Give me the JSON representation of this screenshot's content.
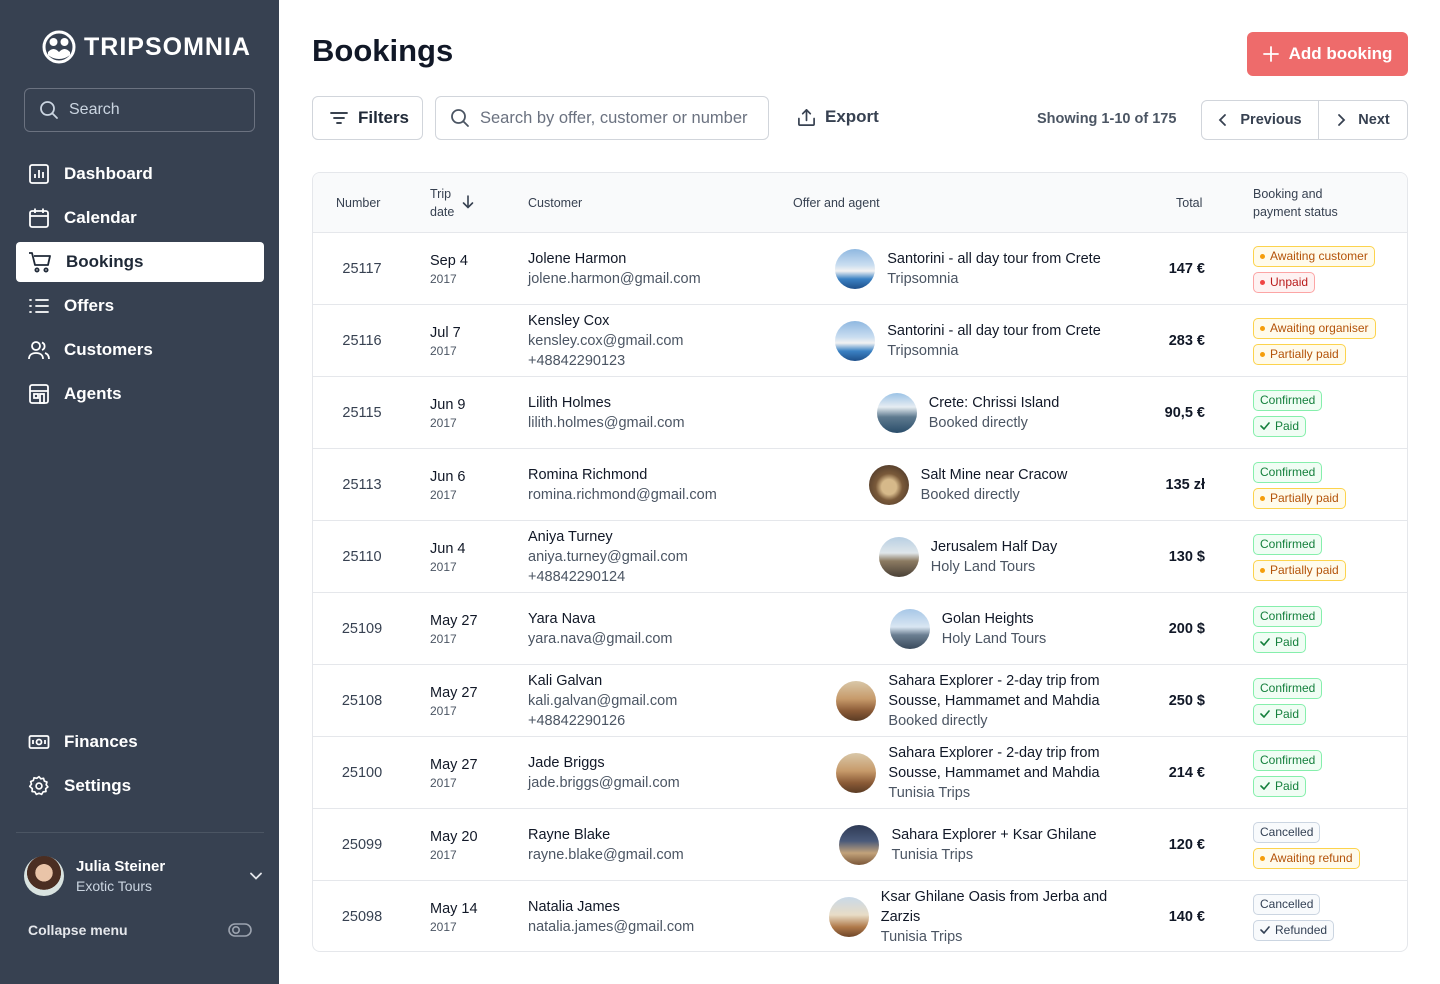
{
  "brand": {
    "name": "TRIPSOMNIA"
  },
  "sidebar": {
    "search_placeholder": "Search",
    "nav_top": [
      {
        "label": "Dashboard",
        "icon": "chart-icon",
        "active": false
      },
      {
        "label": "Calendar",
        "icon": "calendar-icon",
        "active": false
      },
      {
        "label": "Bookings",
        "icon": "cart-icon",
        "active": true
      },
      {
        "label": "Offers",
        "icon": "list-icon",
        "active": false
      },
      {
        "label": "Customers",
        "icon": "users-icon",
        "active": false
      },
      {
        "label": "Agents",
        "icon": "building-icon",
        "active": false
      }
    ],
    "nav_bottom": [
      {
        "label": "Finances",
        "icon": "banknote-icon"
      },
      {
        "label": "Settings",
        "icon": "gear-icon"
      }
    ],
    "user": {
      "name": "Julia Steiner",
      "org": "Exotic Tours"
    },
    "collapse_label": "Collapse menu"
  },
  "header": {
    "title": "Bookings",
    "add_label": "Add booking"
  },
  "toolbar": {
    "filters_label": "Filters",
    "search_placeholder": "Search by offer, customer or number",
    "export_label": "Export",
    "showing": "Showing 1-10 of 175",
    "prev_label": "Previous",
    "next_label": "Next"
  },
  "table": {
    "columns": {
      "number": "Number",
      "trip_date_1": "Trip",
      "trip_date_2": "date",
      "customer": "Customer",
      "offer": "Offer and agent",
      "total": "Total",
      "status_1": "Booking and",
      "status_2": "payment status"
    },
    "rows": [
      {
        "number": "25117",
        "date": "Sep 4",
        "year": "2017",
        "customer": "Jolene Harmon",
        "contact": [
          "jolene.harmon@gmail.com"
        ],
        "offer": [
          "Santorini - all day tour from Crete"
        ],
        "agent": "Tripsomnia",
        "total": "147 €",
        "thumb": "santorini",
        "status": [
          {
            "label": "Awaiting customer",
            "style": "orange",
            "mark": "dot"
          },
          {
            "label": "Unpaid",
            "style": "red",
            "mark": "dot"
          }
        ]
      },
      {
        "number": "25116",
        "date": "Jul 7",
        "year": "2017",
        "customer": "Kensley Cox",
        "contact": [
          "kensley.cox@gmail.com",
          "+48842290123"
        ],
        "offer": [
          "Santorini - all day tour from Crete"
        ],
        "agent": "Tripsomnia",
        "total": "283 €",
        "thumb": "santorini",
        "status": [
          {
            "label": "Awaiting organiser",
            "style": "orange",
            "mark": "dot"
          },
          {
            "label": "Partially paid",
            "style": "orange",
            "mark": "dot"
          }
        ]
      },
      {
        "number": "25115",
        "date": "Jun 9",
        "year": "2017",
        "customer": "Lilith Holmes",
        "contact": [
          "lilith.holmes@gmail.com"
        ],
        "offer": [
          "Crete: Chrissi Island"
        ],
        "agent": "Booked directly",
        "total": "90,5 €",
        "thumb": "crete",
        "status": [
          {
            "label": "Confirmed",
            "style": "green",
            "mark": "none"
          },
          {
            "label": "Paid",
            "style": "green",
            "mark": "check"
          }
        ]
      },
      {
        "number": "25113",
        "date": "Jun 6",
        "year": "2017",
        "customer": "Romina Richmond",
        "contact": [
          "romina.richmond@gmail.com"
        ],
        "offer": [
          "Salt Mine near Cracow"
        ],
        "agent": "Booked directly",
        "total": "135 zł",
        "thumb": "saltmine",
        "status": [
          {
            "label": "Confirmed",
            "style": "green",
            "mark": "none"
          },
          {
            "label": "Partially paid",
            "style": "orange",
            "mark": "dot"
          }
        ]
      },
      {
        "number": "25110",
        "date": "Jun 4",
        "year": "2017",
        "customer": "Aniya Turney",
        "contact": [
          "aniya.turney@gmail.com",
          "+48842290124"
        ],
        "offer": [
          "Jerusalem Half Day"
        ],
        "agent": "Holy Land Tours",
        "total": "130 $",
        "thumb": "jerusalem",
        "status": [
          {
            "label": "Confirmed",
            "style": "green",
            "mark": "none"
          },
          {
            "label": "Partially paid",
            "style": "orange",
            "mark": "dot"
          }
        ]
      },
      {
        "number": "25109",
        "date": "May 27",
        "year": "2017",
        "customer": "Yara Nava",
        "contact": [
          "yara.nava@gmail.com"
        ],
        "offer": [
          "Golan Heights"
        ],
        "agent": "Holy Land Tours",
        "total": "200 $",
        "thumb": "golan",
        "status": [
          {
            "label": "Confirmed",
            "style": "green",
            "mark": "none"
          },
          {
            "label": "Paid",
            "style": "green",
            "mark": "check"
          }
        ]
      },
      {
        "number": "25108",
        "date": "May 27",
        "year": "2017",
        "customer": "Kali Galvan",
        "contact": [
          "kali.galvan@gmail.com",
          "+48842290126"
        ],
        "offer": [
          "Sahara Explorer - 2-day trip from",
          "Sousse, Hammamet and Mahdia"
        ],
        "agent": "Booked directly",
        "total": "250 $",
        "thumb": "sahara",
        "status": [
          {
            "label": "Confirmed",
            "style": "green",
            "mark": "none"
          },
          {
            "label": "Paid",
            "style": "green",
            "mark": "check"
          }
        ]
      },
      {
        "number": "25100",
        "date": "May 27",
        "year": "2017",
        "customer": "Jade Briggs",
        "contact": [
          "jade.briggs@gmail.com"
        ],
        "offer": [
          "Sahara Explorer - 2-day trip from",
          "Sousse, Hammamet and Mahdia"
        ],
        "agent": "Tunisia Trips",
        "total": "214 €",
        "thumb": "sahara",
        "status": [
          {
            "label": "Confirmed",
            "style": "green",
            "mark": "none"
          },
          {
            "label": "Paid",
            "style": "green",
            "mark": "check"
          }
        ]
      },
      {
        "number": "25099",
        "date": "May 20",
        "year": "2017",
        "customer": "Rayne Blake",
        "contact": [
          "rayne.blake@gmail.com"
        ],
        "offer": [
          "Sahara Explorer + Ksar Ghilane"
        ],
        "agent": "Tunisia Trips",
        "total": "120 €",
        "thumb": "ksar",
        "status": [
          {
            "label": "Cancelled",
            "style": "gray",
            "mark": "none"
          },
          {
            "label": "Awaiting refund",
            "style": "orange",
            "mark": "dot"
          }
        ]
      },
      {
        "number": "25098",
        "date": "May 14",
        "year": "2017",
        "customer": "Natalia James",
        "contact": [
          "natalia.james@gmail.com"
        ],
        "offer": [
          "Ksar Ghilane Oasis from Jerba and",
          "Zarzis"
        ],
        "agent": "Tunisia Trips",
        "total": "140 €",
        "thumb": "oasis",
        "status": [
          {
            "label": "Cancelled",
            "style": "gray",
            "mark": "none"
          },
          {
            "label": "Refunded",
            "style": "gray",
            "mark": "check"
          }
        ]
      }
    ]
  },
  "colors": {
    "sidebar_bg": "#374151",
    "accent": "#ee6b6b"
  }
}
